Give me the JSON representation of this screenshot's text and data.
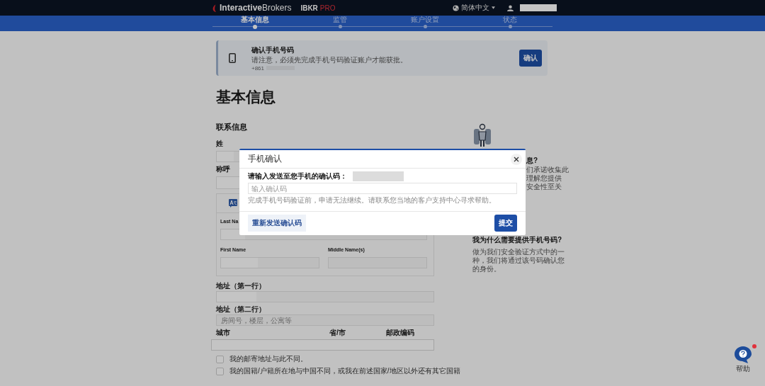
{
  "navbar": {
    "brand": "**Interactive**Brokers",
    "product": "IBKR",
    "product_suffix": "PRO",
    "language": "简体中文"
  },
  "steps": [
    {
      "label": "基本信息",
      "selected": true
    },
    {
      "label": "监管",
      "selected": false
    },
    {
      "label": "账户设置",
      "selected": false
    },
    {
      "label": "状态",
      "selected": false
    }
  ],
  "banner": {
    "title": "确认手机号码",
    "text": "请注意，必须先完成手机号码验证账户才能获批。",
    "phone_prefix": "+861",
    "button": "确认"
  },
  "page_title": "基本信息",
  "form": {
    "section_title": "联系信息",
    "last_name_label": "姓",
    "salutation_label": "称呼",
    "name_panel": {
      "last_name_label": "Last Na",
      "first_name_label": "First Name",
      "middle_name_label": "Middle Name(s)"
    },
    "address1_label": "地址（第一行）",
    "address2_label": "地址（第二行）",
    "address2_placeholder": "房间号，楼层，公寓等",
    "city_label": "城市",
    "province_label": "省/市",
    "postal_label": "邮政编码",
    "checkboxes": [
      {
        "label": "我的邮寄地址与此不同。",
        "checked": false
      },
      {
        "label": "我的国籍/户籍所在地与中国不同，或我在前述国家/地区以外还有其它国籍",
        "checked": false
      }
    ]
  },
  "sidebar": {
    "partial_heading": "息?",
    "partial_lines": [
      "们承诺收集此",
      "理解您提供",
      "安全性至关"
    ],
    "heading": "我为什么需要提供手机号码?",
    "text": "做为我们安全验证方式中的一种，我们将通过该号码确认您的身份。"
  },
  "modal": {
    "title": "手机确认",
    "label": "请输入发送至您手机的确认码：",
    "placeholder": "输入确认码",
    "hint": "完成手机号码验证前，申请无法继续。请联系您当地的客户支持中心寻求帮助。",
    "resend_button": "重新发送确认码",
    "submit_button": "提交"
  },
  "help": {
    "label": "帮助",
    "notification": true
  }
}
